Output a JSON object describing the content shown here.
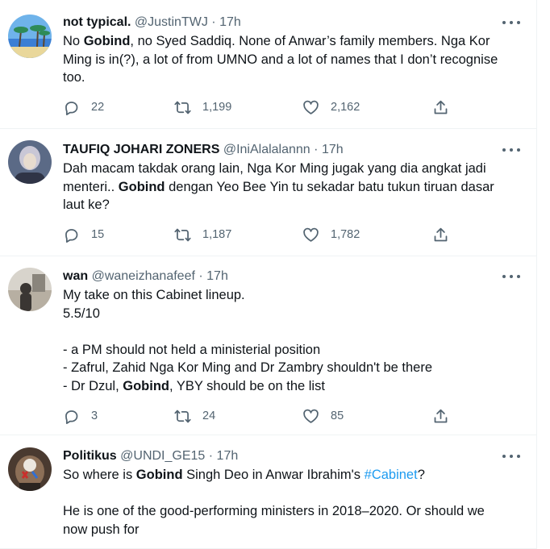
{
  "tweets": [
    {
      "name": "not typical.",
      "handle": "@JustinTWJ",
      "time": "17h",
      "lines": [
        [
          {
            "t": "No "
          },
          {
            "t": "Gobind",
            "b": true
          },
          {
            "t": ", no Syed Saddiq. None of Anwar’s family members. Nga Kor"
          }
        ],
        [
          {
            "t": "Ming is in(?), a lot of from UMNO and a lot of names that I don’t recognise"
          }
        ],
        [
          {
            "t": "too."
          }
        ]
      ],
      "replies": "22",
      "retweets": "1,199",
      "likes": "2,162",
      "avatar": {
        "kind": "beach",
        "colors": [
          "#3b7fd4",
          "#6fb3ea",
          "#2e8b57",
          "#e9d79a"
        ]
      }
    },
    {
      "name": "TAUFIQ JOHARI ZONERS",
      "handle": "@IniAlalalannn",
      "time": "17h",
      "lines": [
        [
          {
            "t": "Dah macam takdak orang lain, Nga Kor Ming jugak yang dia angkat jadi"
          }
        ],
        [
          {
            "t": "menteri.. "
          },
          {
            "t": "Gobind",
            "b": true
          },
          {
            "t": " dengan Yeo Bee Yin tu sekadar batu tukun tiruan dasar"
          }
        ],
        [
          {
            "t": "laut ke?"
          }
        ]
      ],
      "replies": "15",
      "retweets": "1,187",
      "likes": "1,782",
      "avatar": {
        "kind": "portrait",
        "colors": [
          "#5b6a86",
          "#c9c7d6",
          "#e8dccf",
          "#2f3446"
        ]
      }
    },
    {
      "name": "wan",
      "handle": "@waneizhanafeef",
      "time": "17h",
      "lines": [
        [
          {
            "t": "My take on this Cabinet lineup."
          }
        ],
        [
          {
            "t": "5.5/10"
          }
        ],
        [
          {
            "t": " "
          }
        ],
        [
          {
            "t": "- a PM should not held a ministerial position"
          }
        ],
        [
          {
            "t": "- Zafrul, Zahid Nga Kor Ming and Dr Zambry shouldn't be there"
          }
        ],
        [
          {
            "t": "- Dr Dzul, "
          },
          {
            "t": "Gobind",
            "b": true
          },
          {
            "t": ", YBY should be on the list"
          }
        ]
      ],
      "replies": "3",
      "retweets": "24",
      "likes": "85",
      "avatar": {
        "kind": "room",
        "colors": [
          "#d8d4cc",
          "#8a857c",
          "#3a3633",
          "#b7afa2"
        ]
      }
    },
    {
      "name": "Politikus",
      "handle": "@UNDI_GE15",
      "time": "17h",
      "lines": [
        [
          {
            "t": "So where is "
          },
          {
            "t": "Gobind",
            "b": true
          },
          {
            "t": " Singh Deo in Anwar Ibrahim's "
          },
          {
            "t": "#Cabinet",
            "h": true
          },
          {
            "t": "?"
          }
        ],
        [
          {
            "t": " "
          }
        ],
        [
          {
            "t": "He is one of the good-performing ministers in 2018–2020. Or should we"
          }
        ],
        [
          {
            "t": "now push for"
          }
        ]
      ],
      "replies": "",
      "retweets": "",
      "likes": "",
      "avatar": {
        "kind": "eagle",
        "colors": [
          "#4a3a30",
          "#8c6f57",
          "#c9302c",
          "#2f6fd6"
        ]
      }
    }
  ],
  "separator": "·"
}
